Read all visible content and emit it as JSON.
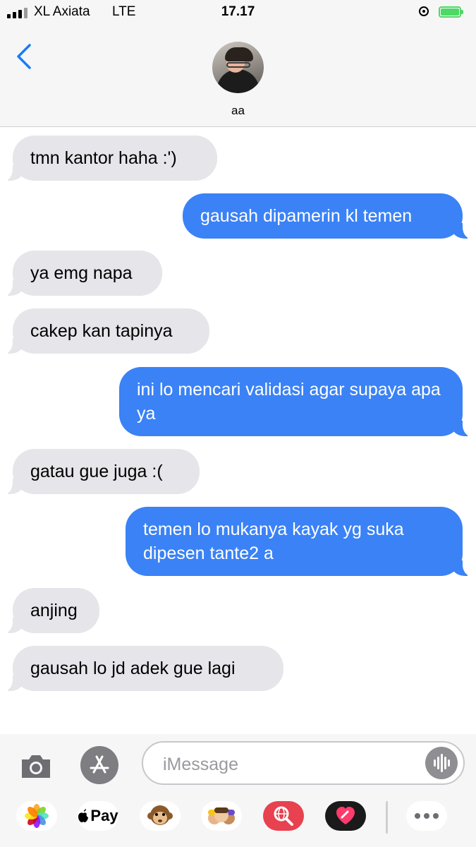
{
  "status_bar": {
    "carrier": "XL Axiata",
    "network": "LTE",
    "time": "17.17"
  },
  "header": {
    "contact_name": "aa"
  },
  "messages": [
    {
      "direction": "incoming",
      "text": "tmn kantor haha :')"
    },
    {
      "direction": "outgoing",
      "text": "gausah dipamerin kl temen"
    },
    {
      "direction": "incoming",
      "text": "ya emg napa"
    },
    {
      "direction": "incoming",
      "text": "cakep kan tapinya"
    },
    {
      "direction": "outgoing",
      "text": "ini lo mencari validasi agar supaya apa ya"
    },
    {
      "direction": "incoming",
      "text": "gatau gue juga :("
    },
    {
      "direction": "outgoing",
      "text": "temen lo mukanya kayak yg suka dipesen tante2 a"
    },
    {
      "direction": "incoming",
      "text": "anjing"
    },
    {
      "direction": "incoming",
      "text": "gausah lo jd adek gue lagi"
    }
  ],
  "composer": {
    "placeholder": "iMessage"
  },
  "app_drawer": {
    "apple_pay_label": "Pay"
  },
  "colors": {
    "incoming_bubble": "#e5e5ea",
    "outgoing_bubble": "#3a82f6",
    "accent": "#147efb",
    "battery": "#4cd964"
  },
  "icons": [
    "back-chevron-icon",
    "camera-icon",
    "app-store-icon",
    "audio-waveform-icon",
    "photos-icon",
    "apple-pay-icon",
    "animoji-monkey-icon",
    "memoji-icon",
    "web-search-icon",
    "digital-touch-icon",
    "more-icon"
  ]
}
